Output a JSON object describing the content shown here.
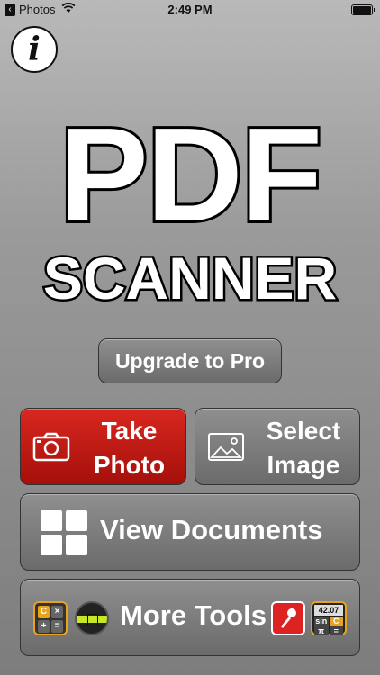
{
  "status_bar": {
    "back_label": "Photos",
    "time": "2:49 PM"
  },
  "info_button": {
    "glyph": "i"
  },
  "logo": {
    "line1": "PDF",
    "line2": "SCANNER"
  },
  "buttons": {
    "upgrade": "Upgrade to Pro",
    "take_photo": {
      "line1": "Take",
      "line2": "Photo"
    },
    "select_image": {
      "line1": "Select",
      "line2": "Image"
    },
    "view_documents": "View Documents",
    "more_tools": "More Tools"
  },
  "tool_icons": {
    "calculator": {
      "keys": [
        "C",
        "×",
        "+",
        "="
      ]
    },
    "scientific": {
      "display": "42.07",
      "keys": [
        "sin",
        "C",
        "π",
        "="
      ]
    }
  },
  "colors": {
    "accent_red": "#c51a14",
    "button_gray": "#7a7a7a",
    "tool_orange": "#e7a31c"
  }
}
